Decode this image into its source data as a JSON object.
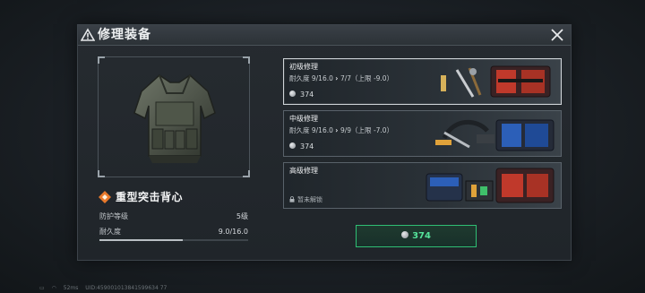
{
  "dialog": {
    "title": "修理装备",
    "close_icon": "close-icon",
    "title_icon": "warning-triangle-icon"
  },
  "item": {
    "name": "重型突击背心",
    "rarity_icon": "orange-diamond-icon",
    "image_icon": "body-armor-vest-icon",
    "protection_label": "防护等级",
    "protection_value": "5级",
    "durability_label": "耐久度",
    "durability_value": "9.0/16.0",
    "durability_fraction": 0.5625
  },
  "repair_options": [
    {
      "title": "初级修理",
      "detail_prefix": "耐久度 9/16.0",
      "detail_suffix": "7/7（上限 -9.0）",
      "cost": "374",
      "selected": true,
      "locked": false
    },
    {
      "title": "中级修理",
      "detail_prefix": "耐久度 9/16.0",
      "detail_suffix": "9/9（上限 -7.0）",
      "cost": "374",
      "selected": false,
      "locked": false
    },
    {
      "title": "高级修理",
      "locked_text": "暂未解锁",
      "selected": false,
      "locked": true
    }
  ],
  "confirm": {
    "cost": "374"
  },
  "status_bar": {
    "ping": "52ms",
    "uid": "UID:459001013841599634 77"
  },
  "colors": {
    "accent_green": "#2fbf74",
    "rarity_orange": "#e8792b"
  }
}
